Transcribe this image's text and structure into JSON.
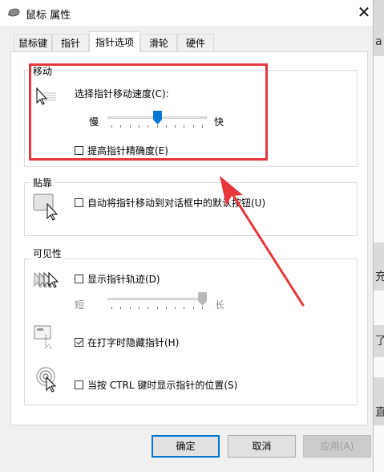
{
  "window": {
    "title": "鼠标 属性"
  },
  "tabs": [
    {
      "label": "鼠标键"
    },
    {
      "label": "指针"
    },
    {
      "label": "指针选项"
    },
    {
      "label": "滑轮"
    },
    {
      "label": "硬件"
    }
  ],
  "motion": {
    "title": "移动",
    "speed_label": "选择指针移动速度(C):",
    "slow": "慢",
    "fast": "快",
    "speed_value_fraction": 0.5,
    "precision_label": "提高指针精确度(E)",
    "precision_checked": false
  },
  "snap": {
    "title": "贴靠",
    "label": "自动将指针移动到对话框中的默认按钮(U)",
    "checked": false
  },
  "visibility": {
    "title": "可见性",
    "trails_label": "显示指针轨迹(D)",
    "trails_checked": false,
    "trails_short": "短",
    "trails_long": "长",
    "trails_value_fraction": 1.0,
    "hide_typing_label": "在打字时隐藏指针(H)",
    "hide_typing_checked": true,
    "ctrl_label": "当按 CTRL 键时显示指针的位置(S)",
    "ctrl_checked": false
  },
  "buttons": {
    "ok": "确定",
    "cancel": "取消",
    "apply": "应用(A)"
  },
  "background": {
    "glyphs": [
      "a",
      "(",
      "充",
      "了",
      "直"
    ]
  },
  "colors": {
    "accent": "#0078d7",
    "annotation": "#e8353b"
  }
}
